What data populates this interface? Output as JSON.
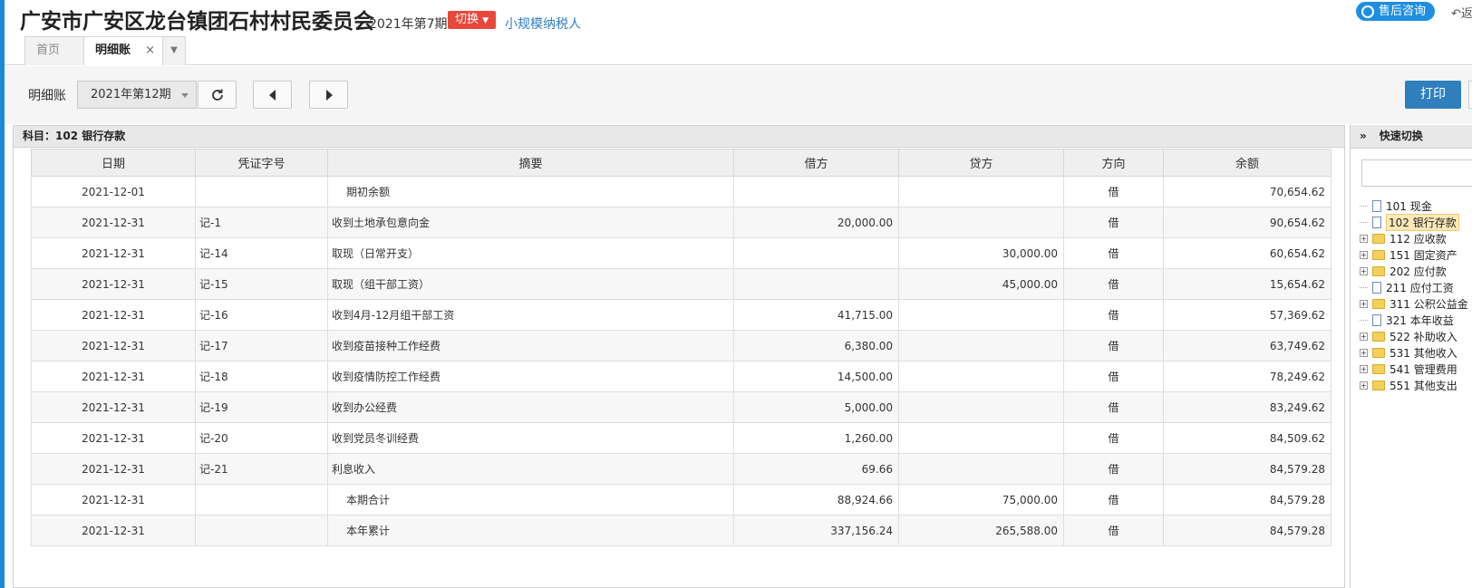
{
  "header": {
    "company": "广安市广安区龙台镇团石村村民委员会",
    "period": "2021年第7期",
    "switch_label": "切换",
    "taxpayer": "小规模纳税人",
    "service_label": "售后咨询",
    "back_label": "返"
  },
  "tabs": [
    {
      "label": "首页"
    },
    {
      "label": "明细账",
      "close": "×"
    }
  ],
  "toolbar": {
    "label": "明细账",
    "period_select": "2021年第12期",
    "print_label": "打印"
  },
  "grid": {
    "subject_label": "科目：102  银行存款",
    "columns": [
      "日期",
      "凭证字号",
      "摘要",
      "借方",
      "贷方",
      "方向",
      "余额"
    ],
    "rows": [
      {
        "date": "2021-12-01",
        "voucher": "",
        "summary": "期初余额",
        "debit": "",
        "credit": "",
        "dir": "借",
        "balance": "70,654.62",
        "indent": true
      },
      {
        "date": "2021-12-31",
        "voucher": "记-1",
        "summary": "收到土地承包意向金",
        "debit": "20,000.00",
        "credit": "",
        "dir": "借",
        "balance": "90,654.62"
      },
      {
        "date": "2021-12-31",
        "voucher": "记-14",
        "summary": "取现（日常开支）",
        "debit": "",
        "credit": "30,000.00",
        "dir": "借",
        "balance": "60,654.62"
      },
      {
        "date": "2021-12-31",
        "voucher": "记-15",
        "summary": "取现（组干部工资）",
        "debit": "",
        "credit": "45,000.00",
        "dir": "借",
        "balance": "15,654.62"
      },
      {
        "date": "2021-12-31",
        "voucher": "记-16",
        "summary": "收到4月-12月组干部工资",
        "debit": "41,715.00",
        "credit": "",
        "dir": "借",
        "balance": "57,369.62"
      },
      {
        "date": "2021-12-31",
        "voucher": "记-17",
        "summary": "收到疫苗接种工作经费",
        "debit": "6,380.00",
        "credit": "",
        "dir": "借",
        "balance": "63,749.62"
      },
      {
        "date": "2021-12-31",
        "voucher": "记-18",
        "summary": "收到疫情防控工作经费",
        "debit": "14,500.00",
        "credit": "",
        "dir": "借",
        "balance": "78,249.62"
      },
      {
        "date": "2021-12-31",
        "voucher": "记-19",
        "summary": "收到办公经费",
        "debit": "5,000.00",
        "credit": "",
        "dir": "借",
        "balance": "83,249.62"
      },
      {
        "date": "2021-12-31",
        "voucher": "记-20",
        "summary": "收到党员冬训经费",
        "debit": "1,260.00",
        "credit": "",
        "dir": "借",
        "balance": "84,509.62"
      },
      {
        "date": "2021-12-31",
        "voucher": "记-21",
        "summary": "利息收入",
        "debit": "69.66",
        "credit": "",
        "dir": "借",
        "balance": "84,579.28"
      },
      {
        "date": "2021-12-31",
        "voucher": "",
        "summary": "本期合计",
        "debit": "88,924.66",
        "credit": "75,000.00",
        "dir": "借",
        "balance": "84,579.28",
        "indent": true
      },
      {
        "date": "2021-12-31",
        "voucher": "",
        "summary": "本年累计",
        "debit": "337,156.24",
        "credit": "265,588.00",
        "dir": "借",
        "balance": "84,579.28",
        "indent": true
      }
    ]
  },
  "quick": {
    "title": "快速切换",
    "collapse_glyph": "»",
    "tree": [
      {
        "label": "101 现金",
        "type": "file"
      },
      {
        "label": "102 银行存款",
        "type": "file",
        "selected": true
      },
      {
        "label": "112 应收款",
        "type": "folder"
      },
      {
        "label": "151 固定资产",
        "type": "folder"
      },
      {
        "label": "202 应付款",
        "type": "folder"
      },
      {
        "label": "211 应付工资",
        "type": "file"
      },
      {
        "label": "311 公积公益金",
        "type": "folder"
      },
      {
        "label": "321 本年收益",
        "type": "file"
      },
      {
        "label": "522 补助收入",
        "type": "folder"
      },
      {
        "label": "531 其他收入",
        "type": "folder"
      },
      {
        "label": "541 管理费用",
        "type": "folder"
      },
      {
        "label": "551 其他支出",
        "type": "folder"
      }
    ]
  },
  "colors": {
    "accent": "#1e88d8",
    "switch": "#e8473b",
    "print": "#2f7fbd",
    "link": "#2f7ec2"
  }
}
